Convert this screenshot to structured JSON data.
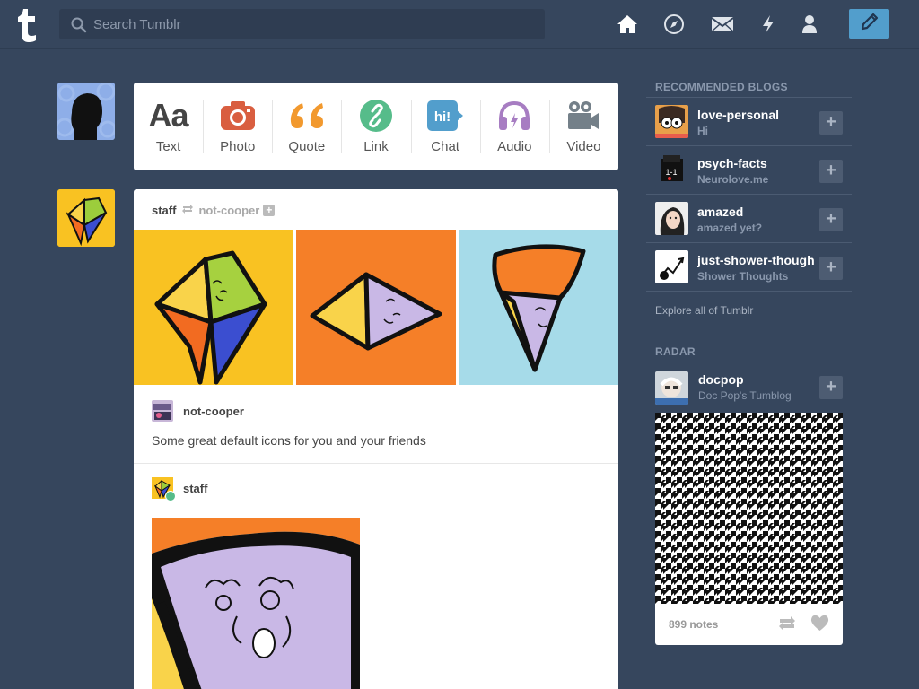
{
  "header": {
    "search_placeholder": "Search Tumblr",
    "nav": [
      "home-icon",
      "explore-icon",
      "inbox-icon",
      "activity-icon",
      "account-icon"
    ],
    "compose": "pencil-icon"
  },
  "post_types": [
    {
      "label": "Text",
      "icon": "text-icon",
      "color": "#444444"
    },
    {
      "label": "Photo",
      "icon": "camera-icon",
      "color": "#d95e40"
    },
    {
      "label": "Quote",
      "icon": "quote-icon",
      "color": "#f2992e"
    },
    {
      "label": "Link",
      "icon": "link-icon",
      "color": "#56bc8a"
    },
    {
      "label": "Chat",
      "icon": "chat-icon",
      "color": "#529ecc"
    },
    {
      "label": "Audio",
      "icon": "headphones-icon",
      "color": "#a77dc2"
    },
    {
      "label": "Video",
      "icon": "video-camera-icon",
      "color": "#748089"
    }
  ],
  "post": {
    "author": "staff",
    "reblogged_from": "not-cooper",
    "reblog_author": "not-cooper",
    "caption": "Some great default icons for you and your friends",
    "second_author": "staff"
  },
  "sidebar": {
    "recommended_title": "RECOMMENDED BLOGS",
    "blogs": [
      {
        "name": "love-personal",
        "subtitle": "Hi"
      },
      {
        "name": "psych-facts",
        "subtitle": "Neurolove.me"
      },
      {
        "name": "amazed",
        "subtitle": "amazed yet?"
      },
      {
        "name": "just-shower-thoughts",
        "subtitle": "Shower Thoughts"
      }
    ],
    "explore_label": "Explore all of Tumblr",
    "radar_title": "RADAR",
    "radar": {
      "name": "docpop",
      "subtitle": "Doc Pop's Tumblog",
      "notes": "899 notes"
    }
  },
  "colors": {
    "background": "#36465d",
    "accent": "#529ecc"
  }
}
